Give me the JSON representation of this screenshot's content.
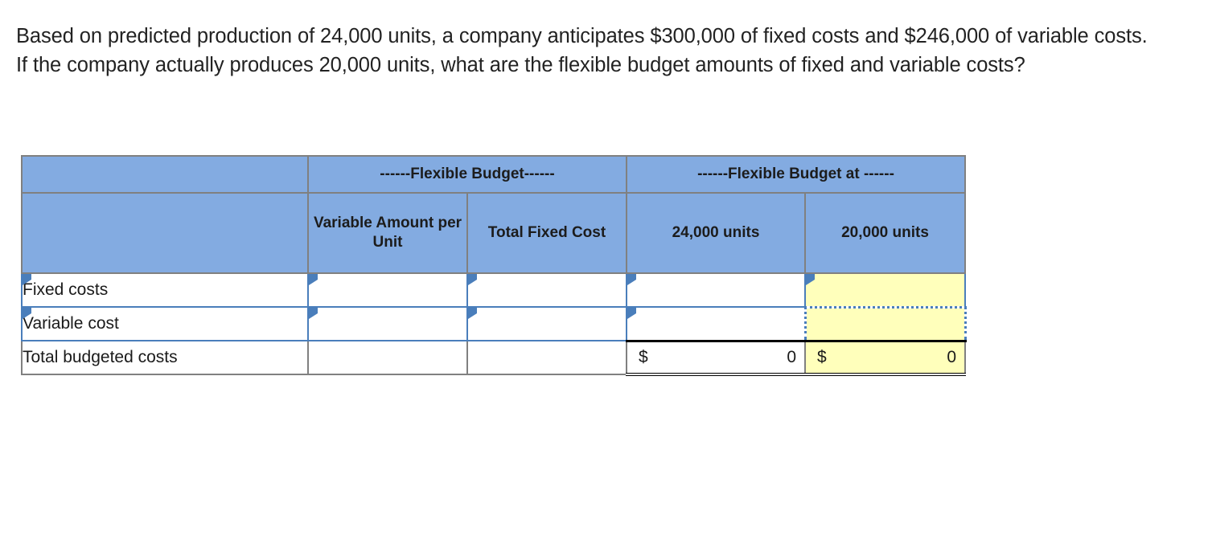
{
  "question": {
    "text": "Based on predicted production of 24,000 units, a company anticipates $300,000 of fixed costs and $246,000 of variable costs. If the company actually produces 20,000 units, what are the flexible budget amounts of fixed and variable costs?"
  },
  "colors": {
    "header_blue": "#83abe1",
    "input_border_blue": "#4a7ebb",
    "highlight_yellow": "#ffffbb",
    "grid_gray": "#808080",
    "text": "#1a1a1a"
  },
  "table": {
    "group_headers": {
      "blank": "",
      "flexible_budget": "------Flexible Budget------",
      "flexible_budget_at": "------Flexible Budget at ------"
    },
    "column_headers": {
      "blank": "",
      "variable_amount_per_unit": "Variable Amount per Unit",
      "total_fixed_cost": "Total Fixed Cost",
      "units_24000": "24,000 units",
      "units_20000": "20,000 units"
    },
    "rows": [
      {
        "label": "Fixed costs",
        "variable_amount_per_unit": "",
        "total_fixed_cost": "",
        "at_24000": "",
        "at_20000": ""
      },
      {
        "label": "Variable cost",
        "variable_amount_per_unit": "",
        "total_fixed_cost": "",
        "at_24000": "",
        "at_20000": ""
      },
      {
        "label": "Total budgeted costs",
        "variable_amount_per_unit": "",
        "total_fixed_cost": "",
        "at_24000_currency": "$",
        "at_24000_value": "0",
        "at_20000_currency": "$",
        "at_20000_value": "0"
      }
    ]
  }
}
